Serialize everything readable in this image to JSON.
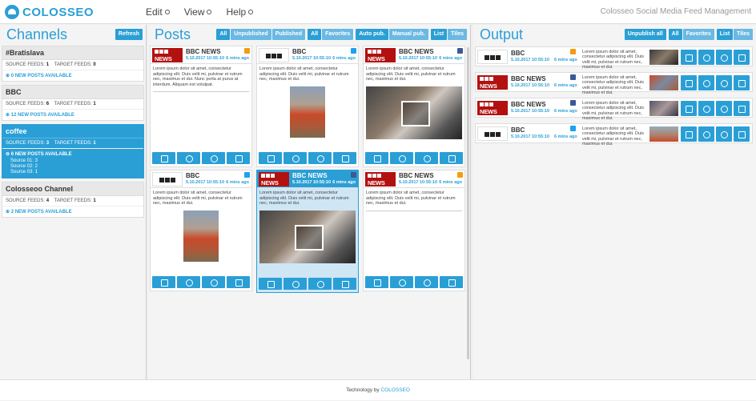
{
  "app": {
    "logo": "COLOSSEO",
    "title": "Colosseo Social Media Feed Management"
  },
  "menu": [
    {
      "label": "Edit"
    },
    {
      "label": "View"
    },
    {
      "label": "Help"
    }
  ],
  "channels": {
    "title": "Channels",
    "refresh": "Refresh",
    "items": [
      {
        "name": "#Bratislava",
        "source_label": "SOURCE FEEDS:",
        "source": "1",
        "target_label": "TARGET FEEDS:",
        "target": "0",
        "new": "0 NEW POSTS AVAILABLE"
      },
      {
        "name": "BBC",
        "source_label": "SOURCE FEEDS:",
        "source": "6",
        "target_label": "TARGET FEEDS:",
        "target": "1",
        "new": "12 NEW POSTS AVAILABLE"
      },
      {
        "name": "coffee",
        "source_label": "SOURCE FEEDS:",
        "source": "3",
        "target_label": "TARGET FEEDS:",
        "target": "1",
        "new": "6 NEW POSTS AVAILABLE",
        "subs": [
          "Source 01: 3",
          "Source 02: 2",
          "Source 03: 1"
        ]
      },
      {
        "name": "Colosseoo Channel",
        "source_label": "SOURCE FEEDS:",
        "source": "4",
        "target_label": "TARGET FEEDS:",
        "target": "1",
        "new": "2 NEW POSTS AVAILABLE"
      }
    ]
  },
  "posts": {
    "title": "Posts",
    "filters": {
      "all": "All",
      "unpublished": "Unpublished",
      "published": "Published",
      "all2": "All",
      "favorites": "Favorites",
      "auto": "Auto pub.",
      "manual": "Manual pub.",
      "list": "List",
      "tiles": "Tiles"
    },
    "cards": [
      {
        "source": "BBC NEWS",
        "date": "5.10.2017 10:55:10",
        "ago": "6 mins ago",
        "net": "rss",
        "text": "Lorem ipsum dolor sit amet, consectetur adipiscing elit. Duis velit mi, pulvinar et rutrum nec, maximus et dui. Nunc porta at purus at interdum. Aliquam est volutpat."
      },
      {
        "source": "BBC",
        "date": "5.10.2017 10:55:10",
        "ago": "6 mins ago",
        "net": "twitter",
        "text": "Lorem ipsum dolor sit amet, consectetur adipiscing elit. Duis velit mi, pulvinar et rutrum nec, maximus et dui."
      },
      {
        "source": "BBC NEWS",
        "date": "5.10.2017 10:55:10",
        "ago": "6 mins ago",
        "net": "facebook",
        "text": "Lorem ipsum dolor sit amet, consectetur adipiscing elit. Duis velit mi, pulvinar et rutrum nec, maximus et dui."
      },
      {
        "source": "BBC",
        "date": "5.10.2017 10:55:10",
        "ago": "6 mins ago",
        "net": "twitter",
        "text": "Lorem ipsum dolor sit amet, consectetur adipiscing elit. Duis velit mi, pulvinar et rutrum nec, maximus et dui."
      },
      {
        "source": "BBC NEWS",
        "date": "5.10.2017 10:55:10",
        "ago": "6 mins ago",
        "net": "facebook",
        "text": "Lorem ipsum dolor sit amet, consectetur adipiscing elit. Duis velit mi, pulvinar et rutrum nec, maximus et dui."
      },
      {
        "source": "BBC NEWS",
        "date": "5.10.2017 10:55:10",
        "ago": "6 mins ago",
        "net": "rss",
        "text": "Lorem ipsum dolor sit amet, consectetur adipiscing elit. Duis velit mi, pulvinar et rutrum nec, maximus et dui."
      }
    ]
  },
  "output": {
    "title": "Output",
    "filters": {
      "unpublish": "Unpublish all",
      "all": "All",
      "favorites": "Favorites",
      "list": "List",
      "tiles": "Tiles"
    },
    "rows": [
      {
        "source": "BBC",
        "date": "5.10.2017 10:55:10",
        "ago": "6 mins ago",
        "net": "rss",
        "text": "Lorem ipsum dolor sit amet, consectetur adipiscing elit. Duis velit mi, pulvinar et rutrum nec, maximus et dui."
      },
      {
        "source": "BBC NEWS",
        "date": "5.10.2017 10:55:10",
        "ago": "6 mins ago",
        "net": "facebook",
        "text": "Lorem ipsum dolor sit amet, consectetur adipiscing elit. Duis velit mi, pulvinar et rutrum nec, maximus et dui."
      },
      {
        "source": "BBC NEWS",
        "date": "5.10.2017 10:55:10",
        "ago": "6 mins ago",
        "net": "facebook",
        "text": "Lorem ipsum dolor sit amet, consectetur adipiscing elit. Duis velit mi, pulvinar et rutrum nec, maximus et dui."
      },
      {
        "source": "BBC",
        "date": "5.10.2017 10:55:10",
        "ago": "6 mins ago",
        "net": "twitter",
        "text": "Lorem ipsum dolor sit amet, consectetur adipiscing elit. Duis velit mi, pulvinar et rutrum nec, maximus et dui."
      }
    ]
  },
  "footer": {
    "prefix": "Technology by",
    "brand": "COLOSSEO"
  },
  "colors": {
    "accent": "#2a9fd6",
    "bbc_red": "#b31010"
  }
}
